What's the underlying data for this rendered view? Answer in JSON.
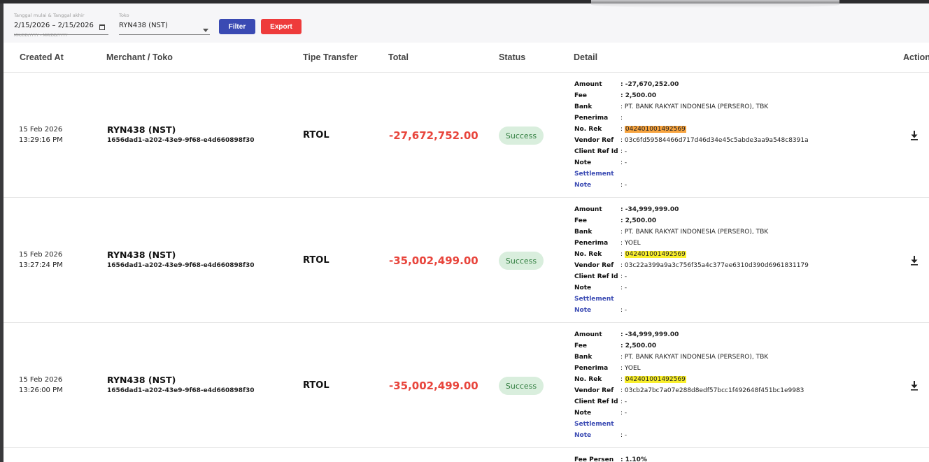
{
  "filters": {
    "date_label": "Tanggal mulai & Tanggal akhir",
    "date_value": "2/15/2026 – 2/15/2026",
    "date_helper": "MM/DD/YYYY – MM/DD/YYYY",
    "toko_label": "Toko",
    "toko_value": "RYN438 (NST)",
    "filter_label": "Filter",
    "export_label": "Export"
  },
  "columns": {
    "created_at": "Created At",
    "merchant": "Merchant / Toko",
    "tipe": "Tipe Transfer",
    "total": "Total",
    "status": "Status",
    "detail": "Detail",
    "action": "Action"
  },
  "detail_keys": {
    "amount": "Amount",
    "fee": "Fee",
    "bank": "Bank",
    "penerima": "Penerima",
    "no_rek": "No. Rek",
    "vendor_ref": "Vendor Ref",
    "client_ref": "Client Ref Id",
    "note": "Note",
    "settlement": "Settlement",
    "settlement_note": "Note",
    "fee_persen": "Fee Persen"
  },
  "rows": [
    {
      "date": "15 Feb 2026",
      "time": "13:29:16 PM",
      "merchant": "RYN438 (NST)",
      "merchant_id": "1656dad1-a202-43e9-9f68-e4d660898f30",
      "tipe": "RTOL",
      "total": "-27,672,752.00",
      "status": "Success",
      "amount": ": -27,670,252.00",
      "fee": ": 2,500.00",
      "bank": ": PT. BANK RAKYAT INDONESIA (PERSERO), TBK",
      "penerima": ":",
      "no_rek": "042401001492569",
      "vendor_ref": ": 03c6fd59584466d717d46d34e45c5abde3aa9a548c8391a",
      "client_ref": ": -",
      "note": ": -",
      "settlement_note": ": -"
    },
    {
      "date": "15 Feb 2026",
      "time": "13:27:24 PM",
      "merchant": "RYN438 (NST)",
      "merchant_id": "1656dad1-a202-43e9-9f68-e4d660898f30",
      "tipe": "RTOL",
      "total": "-35,002,499.00",
      "status": "Success",
      "amount": ": -34,999,999.00",
      "fee": ": 2,500.00",
      "bank": ": PT. BANK RAKYAT INDONESIA (PERSERO), TBK",
      "penerima": ": YOEL",
      "no_rek": "042401001492569",
      "vendor_ref": ": 03c22a399a9a3c756f35a4c377ee6310d390d6961831179",
      "client_ref": ": -",
      "note": ": -",
      "settlement_note": ": -"
    },
    {
      "date": "15 Feb 2026",
      "time": "13:26:00 PM",
      "merchant": "RYN438 (NST)",
      "merchant_id": "1656dad1-a202-43e9-9f68-e4d660898f30",
      "tipe": "RTOL",
      "total": "-35,002,499.00",
      "status": "Success",
      "amount": ": -34,999,999.00",
      "fee": ": 2,500.00",
      "bank": ": PT. BANK RAKYAT INDONESIA (PERSERO), TBK",
      "penerima": ": YOEL",
      "no_rek": "042401001492569",
      "vendor_ref": ": 03cb2a7bc7a07e288d8edf57bcc1f492648f451bc1e9983",
      "client_ref": ": -",
      "note": ": -",
      "settlement_note": ": -"
    }
  ],
  "partial_row": {
    "fee_persen": ": 1.10%"
  },
  "colors": {
    "primary": "#3a4ab3",
    "danger": "#ee3b3b",
    "total_negative": "#e8453c",
    "success_bg": "#d9eedd",
    "success_text": "#2f7d3d",
    "highlight_orange": "#f7a440",
    "highlight_yellow": "#f9ef2d"
  },
  "icons": {
    "calendar": "calendar-icon",
    "dropdown": "chevron-down-icon",
    "download": "download-icon"
  }
}
